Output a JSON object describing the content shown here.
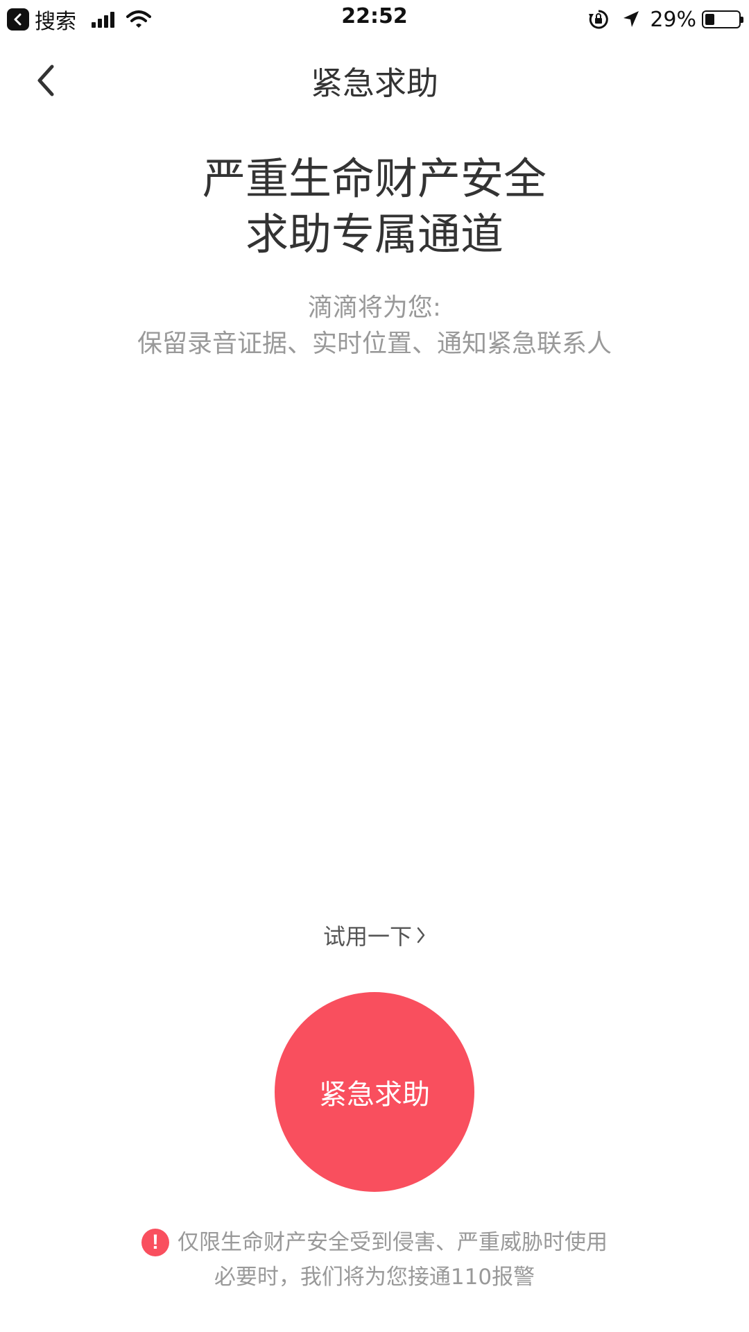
{
  "status_bar": {
    "back_app_label": "搜索",
    "time": "22:52",
    "battery_percent": "29%",
    "battery_level": 0.29,
    "icons": [
      "back-to-app-icon",
      "signal-icon",
      "wifi-icon",
      "orientation-lock-icon",
      "location-arrow-icon",
      "battery-icon"
    ]
  },
  "nav": {
    "title": "紧急求助",
    "back_icon": "chevron-left-icon"
  },
  "headline": {
    "line1": "严重生命财产安全",
    "line2": "求助专属通道"
  },
  "subtext": {
    "line1": "滴滴将为您:",
    "line2": "保留录音证据、实时位置、通知紧急联系人"
  },
  "try_link": {
    "label": "试用一下",
    "icon": "chevron-right-icon"
  },
  "sos_button": {
    "label": "紧急求助",
    "color": "#f94f5e"
  },
  "warning": {
    "icon": "exclamation-icon",
    "line1": "仅限生命财产安全受到侵害、严重威胁时使用",
    "line2": "必要时，我们将为您接通110报警"
  }
}
